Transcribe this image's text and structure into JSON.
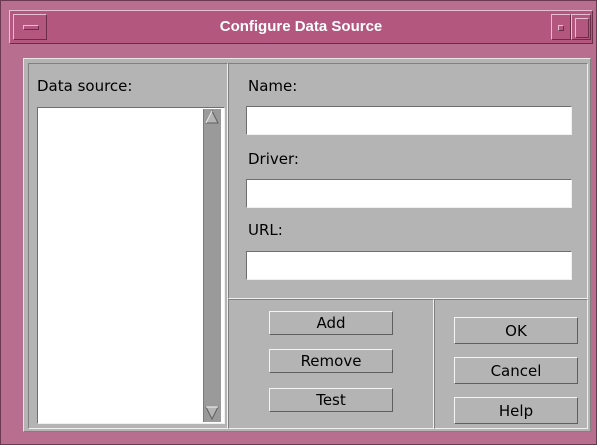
{
  "window": {
    "title": "Configure Data Source"
  },
  "left": {
    "label": "Data source:",
    "items": []
  },
  "form": {
    "name": {
      "label": "Name:",
      "value": ""
    },
    "driver": {
      "label": "Driver:",
      "value": ""
    },
    "url": {
      "label": "URL:",
      "value": ""
    }
  },
  "actions": {
    "add": "Add",
    "remove": "Remove",
    "test": "Test"
  },
  "dialog_buttons": {
    "ok": "OK",
    "cancel": "Cancel",
    "help": "Help"
  },
  "colors": {
    "titlebar": "#b3577f",
    "frame": "#b86f8f",
    "client": "#b4b4b4"
  },
  "icons": {
    "menu": "window-menu-icon",
    "minimize": "minimize-icon",
    "maximize": "maximize-icon",
    "scroll_up": "arrow-up-icon",
    "scroll_down": "arrow-down-icon"
  }
}
